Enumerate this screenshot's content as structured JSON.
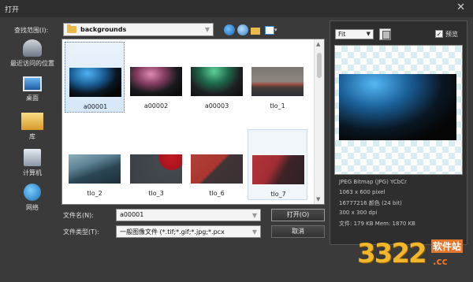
{
  "window": {
    "title": "打开",
    "close_glyph": "✕"
  },
  "lookin": {
    "label": "查找范围(I):",
    "value": "backgrounds"
  },
  "toolbar": {
    "view_arrow": "▾"
  },
  "places": [
    {
      "label": "最近访问的位置",
      "icon": "recent-places-icon"
    },
    {
      "label": "桌面",
      "icon": "desktop-icon"
    },
    {
      "label": "库",
      "icon": "libraries-icon"
    },
    {
      "label": "计算机",
      "icon": "computer-icon"
    },
    {
      "label": "网络",
      "icon": "network-icon"
    }
  ],
  "files": [
    {
      "name": "a00001",
      "selected": true
    },
    {
      "name": "a00002"
    },
    {
      "name": "a00003"
    },
    {
      "name": "tlo_1"
    },
    {
      "name": "tlo_2"
    },
    {
      "name": "tlo_3"
    },
    {
      "name": "tlo_6"
    },
    {
      "name": "tlo_7",
      "hovered": true
    }
  ],
  "filename": {
    "label": "文件名(N):",
    "value": "a00001"
  },
  "filetype": {
    "label": "文件类型(T):",
    "value": "一般图像文件 (*.tif;*.gif;*.jpg;*.pcx"
  },
  "buttons": {
    "open": "打开(O)",
    "cancel": "取消"
  },
  "preview": {
    "fit": "Fit",
    "checkbox_label": "预览",
    "checked": true,
    "check_glyph": "✓",
    "info": [
      "JPEG Bitmap (JPG) YCbCr",
      "1063 x 600 pixel",
      "16777216 颜色 (24 bit)",
      "300 x 300 dpi",
      "文件: 179 KB    Mem: 1870 KB"
    ]
  },
  "watermark": {
    "logo": "3322",
    "text": "软件站",
    "url": ".cc"
  },
  "glyphs": {
    "down": "▼",
    "up": "▲"
  }
}
